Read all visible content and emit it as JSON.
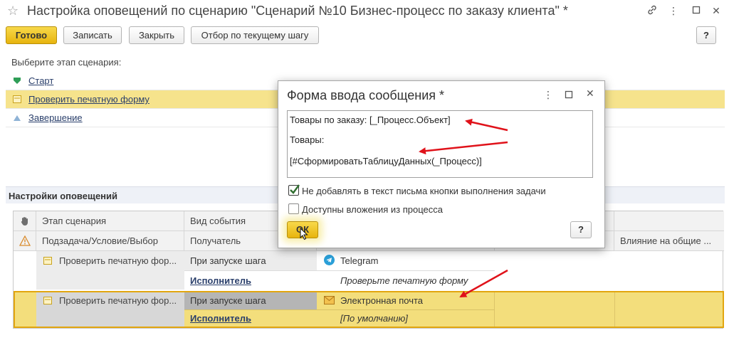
{
  "window": {
    "title": "Настройка оповещений по сценарию \"Сценарий №10 Бизнес-процесс по заказу клиента\" *",
    "icons": [
      "star-icon",
      "link-icon",
      "more-icon",
      "maximize-icon",
      "close-icon"
    ]
  },
  "toolbar": {
    "done": "Готово",
    "save": "Записать",
    "close": "Закрыть",
    "filter": "Отбор по текущему шагу",
    "help": "?"
  },
  "stages": {
    "label": "Выберите этап сценария:",
    "items": [
      {
        "label": "Старт",
        "icon": "start-icon",
        "color": "#2f9e57"
      },
      {
        "label": "Проверить печатную форму",
        "icon": "task-icon",
        "color": "#e2c13a"
      },
      {
        "label": "Завершение",
        "icon": "finish-icon",
        "color": "#8fb3d6"
      }
    ]
  },
  "notifications": {
    "title": "Настройки оповещений",
    "header_row1": {
      "stage": "Этап сценария",
      "event": "Вид события"
    },
    "header_row2": {
      "subtask": "Подзадача/Условие/Выбор",
      "recipient": "Получатель",
      "influence": "Влияние на общие ..."
    },
    "rows": [
      {
        "stage": "Проверить печатную фор...",
        "event": "При запуске шага",
        "channel": "Telegram",
        "recipient": "Исполнитель",
        "message": "Проверьте печатную форму"
      },
      {
        "stage": "Проверить печатную фор...",
        "event": "При запуске шага",
        "channel": "Электронная почта",
        "recipient": "Исполнитель",
        "message": "[По умолчанию]"
      }
    ]
  },
  "dialog": {
    "title": "Форма ввода сообщения *",
    "text_lines": [
      "Товары по заказу: [_Процесс.Объект]",
      "Товары:",
      "[#СформироватьТаблицуДанных(_Процесс)]"
    ],
    "checkbox1": {
      "label": "Не добавлять в текст письма кнопки выполнения задачи",
      "checked": true
    },
    "checkbox2": {
      "label": "Доступны вложения из процесса",
      "checked": false
    },
    "ok": "ОК",
    "help": "?"
  },
  "colors": {
    "accent": "#e7b40e",
    "selected_row": "#f6e38c",
    "annotation_arrow": "#e0121a"
  }
}
